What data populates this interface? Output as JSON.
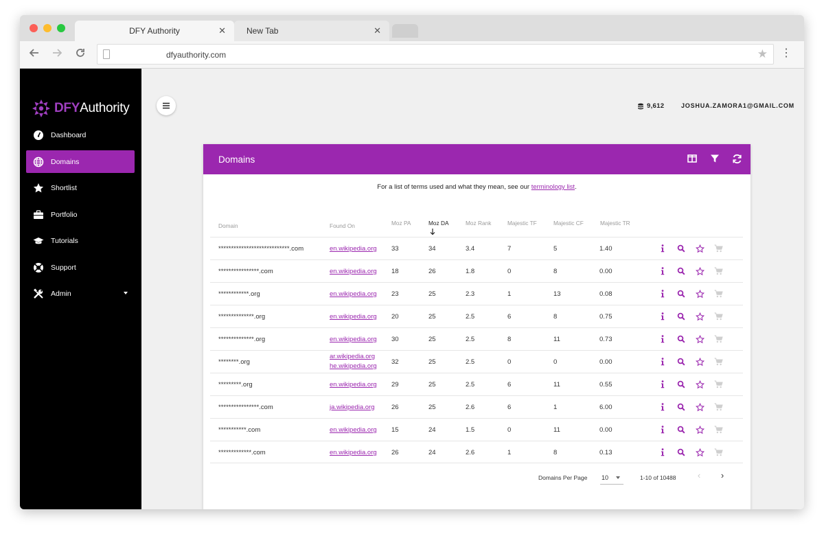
{
  "browser": {
    "tabs": [
      {
        "title": "DFY Authority",
        "active": true
      },
      {
        "title": "New Tab",
        "active": false
      }
    ],
    "url": "dfyauthority.com"
  },
  "brand": {
    "prefix": "DFY",
    "suffix": "Authority",
    "accent": "#9b27af"
  },
  "sidebar": {
    "items": [
      {
        "label": "Dashboard",
        "icon": "speedometer-icon",
        "active": false
      },
      {
        "label": "Domains",
        "icon": "globe-icon",
        "active": true
      },
      {
        "label": "Shortlist",
        "icon": "star-icon",
        "active": false
      },
      {
        "label": "Portfolio",
        "icon": "briefcase-icon",
        "active": false
      },
      {
        "label": "Tutorials",
        "icon": "graduation-cap-icon",
        "active": false
      },
      {
        "label": "Support",
        "icon": "lifebuoy-icon",
        "active": false
      },
      {
        "label": "Admin",
        "icon": "tools-icon",
        "active": false
      }
    ]
  },
  "header": {
    "credits": "9,612",
    "email": "JOSHUA.ZAMORA1@GMAIL.COM"
  },
  "card": {
    "title": "Domains",
    "terms_prefix": "For a list of terms used and what they mean, see our",
    "terms_link": "terminology list",
    "terms_suffix": "."
  },
  "table": {
    "columns": [
      "Domain",
      "Found On",
      "Moz PA",
      "Moz DA",
      "Moz Rank",
      "Majestic TF",
      "Majestic CF",
      "Majestic TR"
    ],
    "sorted_column": "Moz DA",
    "rows": [
      {
        "domain": "****************************.com",
        "found_on": [
          "en.wikipedia.org"
        ],
        "pa": "33",
        "da": "34",
        "rank": "3.4",
        "tf": "7",
        "cf": "5",
        "tr": "1.40"
      },
      {
        "domain": "****************.com",
        "found_on": [
          "en.wikipedia.org"
        ],
        "pa": "18",
        "da": "26",
        "rank": "1.8",
        "tf": "0",
        "cf": "8",
        "tr": "0.00"
      },
      {
        "domain": "************.org",
        "found_on": [
          "en.wikipedia.org"
        ],
        "pa": "23",
        "da": "25",
        "rank": "2.3",
        "tf": "1",
        "cf": "13",
        "tr": "0.08"
      },
      {
        "domain": "**************.org",
        "found_on": [
          "en.wikipedia.org"
        ],
        "pa": "20",
        "da": "25",
        "rank": "2.5",
        "tf": "6",
        "cf": "8",
        "tr": "0.75"
      },
      {
        "domain": "**************.org",
        "found_on": [
          "en.wikipedia.org"
        ],
        "pa": "30",
        "da": "25",
        "rank": "2.5",
        "tf": "8",
        "cf": "11",
        "tr": "0.73"
      },
      {
        "domain": "********.org",
        "found_on": [
          "ar.wikipedia.org",
          "he.wikipedia.org"
        ],
        "pa": "32",
        "da": "25",
        "rank": "2.5",
        "tf": "0",
        "cf": "0",
        "tr": "0.00"
      },
      {
        "domain": "*********.org",
        "found_on": [
          "en.wikipedia.org"
        ],
        "pa": "29",
        "da": "25",
        "rank": "2.5",
        "tf": "6",
        "cf": "11",
        "tr": "0.55"
      },
      {
        "domain": "****************.com",
        "found_on": [
          "ja.wikipedia.org"
        ],
        "pa": "26",
        "da": "25",
        "rank": "2.6",
        "tf": "6",
        "cf": "1",
        "tr": "6.00"
      },
      {
        "domain": "***********.com",
        "found_on": [
          "en.wikipedia.org"
        ],
        "pa": "15",
        "da": "24",
        "rank": "1.5",
        "tf": "0",
        "cf": "11",
        "tr": "0.00"
      },
      {
        "domain": "*************.com",
        "found_on": [
          "en.wikipedia.org"
        ],
        "pa": "26",
        "da": "24",
        "rank": "2.6",
        "tf": "1",
        "cf": "8",
        "tr": "0.13"
      }
    ]
  },
  "pagination": {
    "per_page_label": "Domains Per Page",
    "per_page_value": "10",
    "range": "1-10 of 10488"
  }
}
